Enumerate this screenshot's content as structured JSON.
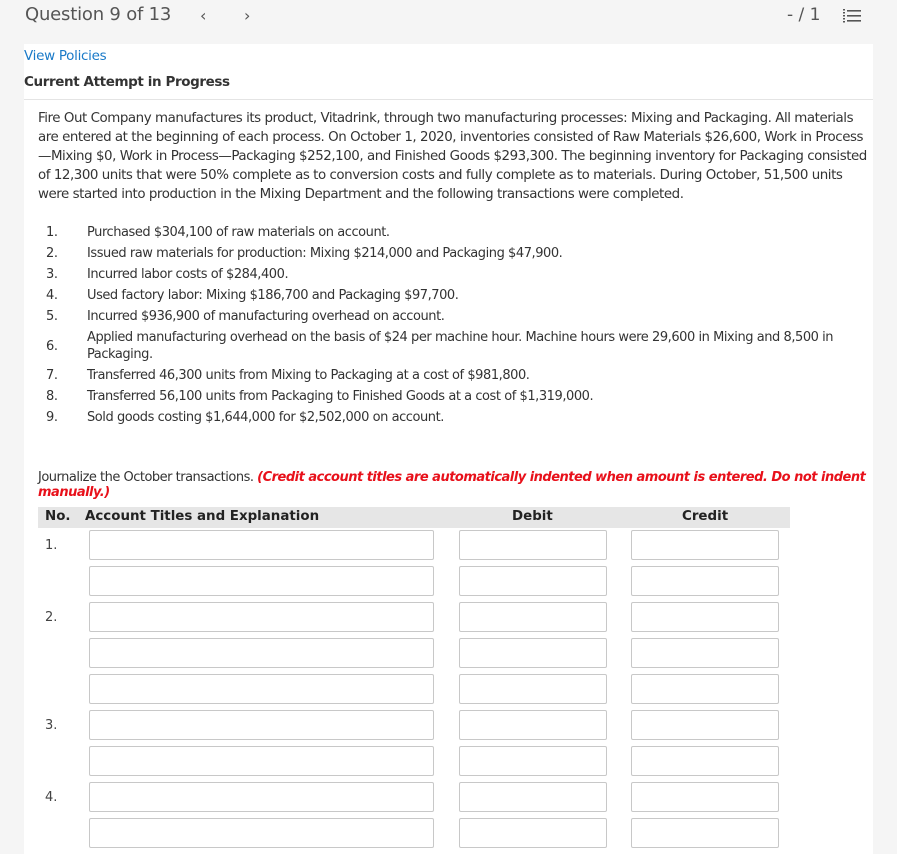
{
  "header": {
    "question_label": "Question 9 of 13",
    "prev_icon": "‹",
    "next_icon": "›",
    "page_count": "- / 1",
    "list_icon": "numbered-list-icon"
  },
  "links": {
    "view_policies": "View Policies"
  },
  "attempt_status": "Current Attempt in Progress",
  "problem": {
    "text": "Fire Out Company manufactures its product, Vitadrink, through two manufacturing processes: Mixing and Packaging. All materials are entered at the beginning of each process. On October 1, 2020, inventories consisted of Raw Materials $26,600, Work in Process —Mixing $0, Work in Process—Packaging $252,100, and Finished Goods $293,300. The beginning inventory for Packaging consisted of 12,300 units that were 50% complete as to conversion costs and fully complete as to materials. During October, 51,500 units were started into production in the Mixing Department and the following transactions were completed."
  },
  "transactions": [
    {
      "num": "1.",
      "text": "Purchased $304,100 of raw materials on account."
    },
    {
      "num": "2.",
      "text": "Issued raw materials for production: Mixing $214,000 and Packaging $47,900."
    },
    {
      "num": "3.",
      "text": "Incurred labor costs of $284,400."
    },
    {
      "num": "4.",
      "text": "Used factory labor: Mixing $186,700 and Packaging $97,700."
    },
    {
      "num": "5.",
      "text": "Incurred $936,900 of manufacturing overhead on account."
    },
    {
      "num": "6.",
      "text": "Applied manufacturing overhead on the basis of $24 per machine hour. Machine hours were 29,600 in Mixing and 8,500 in Packaging."
    },
    {
      "num": "7.",
      "text": "Transferred 46,300 units from Mixing to Packaging at a cost of $981,800."
    },
    {
      "num": "8.",
      "text": "Transferred 56,100 units from Packaging to Finished Goods at a cost of $1,319,000."
    },
    {
      "num": "9.",
      "text": "Sold goods costing $1,644,000 for $2,502,000 on account."
    }
  ],
  "instructions": {
    "text": "Journalize the October transactions.",
    "warning": "(Credit account titles are automatically indented when amount is entered. Do not indent manually.)"
  },
  "journal": {
    "headers": {
      "no": "No.",
      "account": "Account Titles and Explanation",
      "debit": "Debit",
      "credit": "Credit"
    },
    "rows": [
      {
        "no": "1.",
        "account": "",
        "debit": "",
        "credit": ""
      },
      {
        "no": "",
        "account": "",
        "debit": "",
        "credit": ""
      },
      {
        "no": "2.",
        "account": "",
        "debit": "",
        "credit": ""
      },
      {
        "no": "",
        "account": "",
        "debit": "",
        "credit": ""
      },
      {
        "no": "",
        "account": "",
        "debit": "",
        "credit": ""
      },
      {
        "no": "3.",
        "account": "",
        "debit": "",
        "credit": ""
      },
      {
        "no": "",
        "account": "",
        "debit": "",
        "credit": ""
      },
      {
        "no": "4.",
        "account": "",
        "debit": "",
        "credit": ""
      },
      {
        "no": "",
        "account": "",
        "debit": "",
        "credit": ""
      }
    ]
  }
}
